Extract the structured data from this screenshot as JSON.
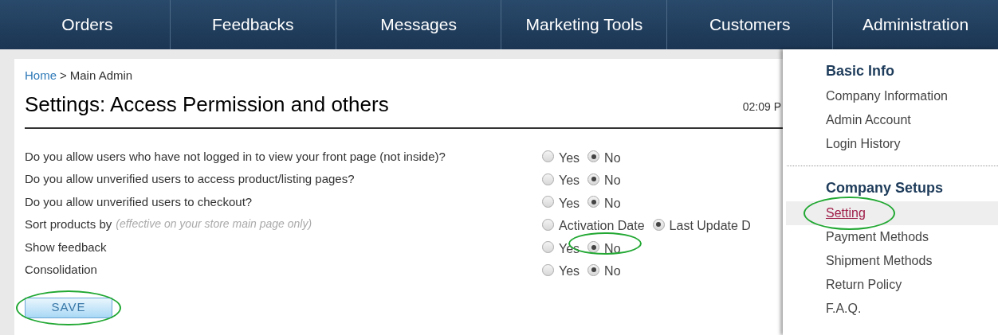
{
  "nav": [
    {
      "label": "Orders"
    },
    {
      "label": "Feedbacks"
    },
    {
      "label": "Messages"
    },
    {
      "label": "Marketing Tools"
    },
    {
      "label": "Customers"
    },
    {
      "label": "Administration"
    }
  ],
  "breadcrumb": {
    "link": "Home",
    "separator": ">",
    "current": "Main Admin"
  },
  "title": "Settings: Access Permission and others",
  "time": "02:09 P",
  "settings": [
    {
      "label": "Do you allow users who have not logged in to view your front page (not inside)?",
      "options": [
        {
          "label": "Yes",
          "selected": false,
          "circled": false
        },
        {
          "label": "No",
          "selected": true,
          "circled": false
        }
      ]
    },
    {
      "label": "Do you allow unverified users to access product/listing pages?",
      "options": [
        {
          "label": "Yes",
          "selected": false,
          "circled": false
        },
        {
          "label": "No",
          "selected": true,
          "circled": false
        }
      ]
    },
    {
      "label": "Do you allow unverified users to checkout?",
      "options": [
        {
          "label": "Yes",
          "selected": false,
          "circled": false
        },
        {
          "label": "No",
          "selected": true,
          "circled": false
        }
      ]
    },
    {
      "label": "Sort products by",
      "note": "(effective on your store main page only)",
      "options": [
        {
          "label": "Activation Date",
          "selected": false,
          "circled": false
        },
        {
          "label": "Last Update D",
          "selected": true,
          "circled": false
        }
      ]
    },
    {
      "label": "Show feedback",
      "options": [
        {
          "label": "Yes",
          "selected": false,
          "circled": false
        },
        {
          "label": "No",
          "selected": true,
          "circled": true
        }
      ]
    },
    {
      "label": "Consolidation",
      "options": [
        {
          "label": "Yes",
          "selected": false,
          "circled": false
        },
        {
          "label": "No",
          "selected": true,
          "circled": false
        }
      ]
    }
  ],
  "save_button": {
    "label": "SAVE",
    "circled": true
  },
  "menu": [
    {
      "heading": "Basic Info",
      "items": [
        {
          "label": "Company Information",
          "selected": false,
          "circled": false
        },
        {
          "label": "Admin Account",
          "selected": false,
          "circled": false
        },
        {
          "label": "Login History",
          "selected": false,
          "circled": false
        }
      ]
    },
    {
      "heading": "Company Setups",
      "items": [
        {
          "label": "Setting",
          "selected": true,
          "circled": true
        },
        {
          "label": "Payment Methods",
          "selected": false,
          "circled": false
        },
        {
          "label": "Shipment Methods",
          "selected": false,
          "circled": false
        },
        {
          "label": "Return Policy",
          "selected": false,
          "circled": false
        },
        {
          "label": "F.A.Q.",
          "selected": false,
          "circled": false
        }
      ]
    }
  ]
}
